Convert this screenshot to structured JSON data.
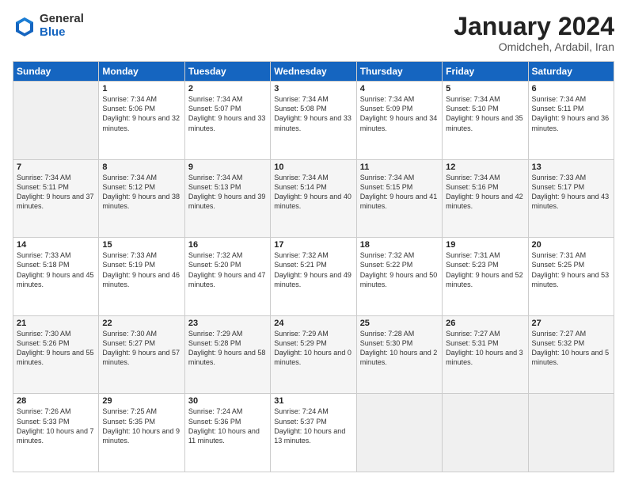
{
  "logo": {
    "general": "General",
    "blue": "Blue"
  },
  "title": {
    "month": "January 2024",
    "location": "Omidcheh, Ardabil, Iran"
  },
  "weekdays": [
    "Sunday",
    "Monday",
    "Tuesday",
    "Wednesday",
    "Thursday",
    "Friday",
    "Saturday"
  ],
  "weeks": [
    [
      {
        "day": "",
        "sunrise": "",
        "sunset": "",
        "daylight": ""
      },
      {
        "day": "1",
        "sunrise": "Sunrise: 7:34 AM",
        "sunset": "Sunset: 5:06 PM",
        "daylight": "Daylight: 9 hours and 32 minutes."
      },
      {
        "day": "2",
        "sunrise": "Sunrise: 7:34 AM",
        "sunset": "Sunset: 5:07 PM",
        "daylight": "Daylight: 9 hours and 33 minutes."
      },
      {
        "day": "3",
        "sunrise": "Sunrise: 7:34 AM",
        "sunset": "Sunset: 5:08 PM",
        "daylight": "Daylight: 9 hours and 33 minutes."
      },
      {
        "day": "4",
        "sunrise": "Sunrise: 7:34 AM",
        "sunset": "Sunset: 5:09 PM",
        "daylight": "Daylight: 9 hours and 34 minutes."
      },
      {
        "day": "5",
        "sunrise": "Sunrise: 7:34 AM",
        "sunset": "Sunset: 5:10 PM",
        "daylight": "Daylight: 9 hours and 35 minutes."
      },
      {
        "day": "6",
        "sunrise": "Sunrise: 7:34 AM",
        "sunset": "Sunset: 5:11 PM",
        "daylight": "Daylight: 9 hours and 36 minutes."
      }
    ],
    [
      {
        "day": "7",
        "sunrise": "Sunrise: 7:34 AM",
        "sunset": "Sunset: 5:11 PM",
        "daylight": "Daylight: 9 hours and 37 minutes."
      },
      {
        "day": "8",
        "sunrise": "Sunrise: 7:34 AM",
        "sunset": "Sunset: 5:12 PM",
        "daylight": "Daylight: 9 hours and 38 minutes."
      },
      {
        "day": "9",
        "sunrise": "Sunrise: 7:34 AM",
        "sunset": "Sunset: 5:13 PM",
        "daylight": "Daylight: 9 hours and 39 minutes."
      },
      {
        "day": "10",
        "sunrise": "Sunrise: 7:34 AM",
        "sunset": "Sunset: 5:14 PM",
        "daylight": "Daylight: 9 hours and 40 minutes."
      },
      {
        "day": "11",
        "sunrise": "Sunrise: 7:34 AM",
        "sunset": "Sunset: 5:15 PM",
        "daylight": "Daylight: 9 hours and 41 minutes."
      },
      {
        "day": "12",
        "sunrise": "Sunrise: 7:34 AM",
        "sunset": "Sunset: 5:16 PM",
        "daylight": "Daylight: 9 hours and 42 minutes."
      },
      {
        "day": "13",
        "sunrise": "Sunrise: 7:33 AM",
        "sunset": "Sunset: 5:17 PM",
        "daylight": "Daylight: 9 hours and 43 minutes."
      }
    ],
    [
      {
        "day": "14",
        "sunrise": "Sunrise: 7:33 AM",
        "sunset": "Sunset: 5:18 PM",
        "daylight": "Daylight: 9 hours and 45 minutes."
      },
      {
        "day": "15",
        "sunrise": "Sunrise: 7:33 AM",
        "sunset": "Sunset: 5:19 PM",
        "daylight": "Daylight: 9 hours and 46 minutes."
      },
      {
        "day": "16",
        "sunrise": "Sunrise: 7:32 AM",
        "sunset": "Sunset: 5:20 PM",
        "daylight": "Daylight: 9 hours and 47 minutes."
      },
      {
        "day": "17",
        "sunrise": "Sunrise: 7:32 AM",
        "sunset": "Sunset: 5:21 PM",
        "daylight": "Daylight: 9 hours and 49 minutes."
      },
      {
        "day": "18",
        "sunrise": "Sunrise: 7:32 AM",
        "sunset": "Sunset: 5:22 PM",
        "daylight": "Daylight: 9 hours and 50 minutes."
      },
      {
        "day": "19",
        "sunrise": "Sunrise: 7:31 AM",
        "sunset": "Sunset: 5:23 PM",
        "daylight": "Daylight: 9 hours and 52 minutes."
      },
      {
        "day": "20",
        "sunrise": "Sunrise: 7:31 AM",
        "sunset": "Sunset: 5:25 PM",
        "daylight": "Daylight: 9 hours and 53 minutes."
      }
    ],
    [
      {
        "day": "21",
        "sunrise": "Sunrise: 7:30 AM",
        "sunset": "Sunset: 5:26 PM",
        "daylight": "Daylight: 9 hours and 55 minutes."
      },
      {
        "day": "22",
        "sunrise": "Sunrise: 7:30 AM",
        "sunset": "Sunset: 5:27 PM",
        "daylight": "Daylight: 9 hours and 57 minutes."
      },
      {
        "day": "23",
        "sunrise": "Sunrise: 7:29 AM",
        "sunset": "Sunset: 5:28 PM",
        "daylight": "Daylight: 9 hours and 58 minutes."
      },
      {
        "day": "24",
        "sunrise": "Sunrise: 7:29 AM",
        "sunset": "Sunset: 5:29 PM",
        "daylight": "Daylight: 10 hours and 0 minutes."
      },
      {
        "day": "25",
        "sunrise": "Sunrise: 7:28 AM",
        "sunset": "Sunset: 5:30 PM",
        "daylight": "Daylight: 10 hours and 2 minutes."
      },
      {
        "day": "26",
        "sunrise": "Sunrise: 7:27 AM",
        "sunset": "Sunset: 5:31 PM",
        "daylight": "Daylight: 10 hours and 3 minutes."
      },
      {
        "day": "27",
        "sunrise": "Sunrise: 7:27 AM",
        "sunset": "Sunset: 5:32 PM",
        "daylight": "Daylight: 10 hours and 5 minutes."
      }
    ],
    [
      {
        "day": "28",
        "sunrise": "Sunrise: 7:26 AM",
        "sunset": "Sunset: 5:33 PM",
        "daylight": "Daylight: 10 hours and 7 minutes."
      },
      {
        "day": "29",
        "sunrise": "Sunrise: 7:25 AM",
        "sunset": "Sunset: 5:35 PM",
        "daylight": "Daylight: 10 hours and 9 minutes."
      },
      {
        "day": "30",
        "sunrise": "Sunrise: 7:24 AM",
        "sunset": "Sunset: 5:36 PM",
        "daylight": "Daylight: 10 hours and 11 minutes."
      },
      {
        "day": "31",
        "sunrise": "Sunrise: 7:24 AM",
        "sunset": "Sunset: 5:37 PM",
        "daylight": "Daylight: 10 hours and 13 minutes."
      },
      {
        "day": "",
        "sunrise": "",
        "sunset": "",
        "daylight": ""
      },
      {
        "day": "",
        "sunrise": "",
        "sunset": "",
        "daylight": ""
      },
      {
        "day": "",
        "sunrise": "",
        "sunset": "",
        "daylight": ""
      }
    ]
  ]
}
